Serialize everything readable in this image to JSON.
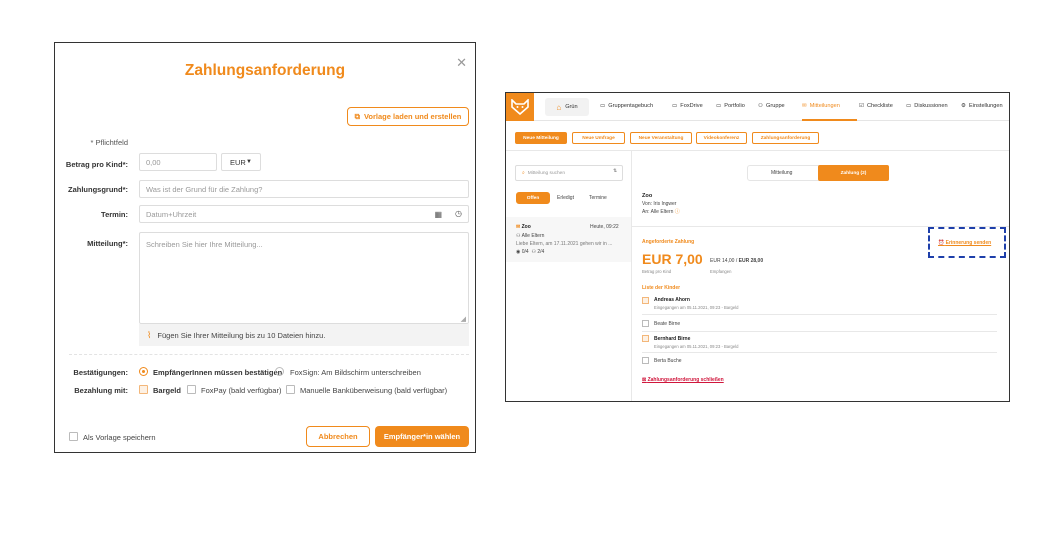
{
  "form": {
    "title": "Zahlungsanforderung",
    "close_icon": "close-icon",
    "template_button": "Vorlage laden und erstellen",
    "required_note": "* Pflichtfeld",
    "amount_label": "Betrag pro Kind*:",
    "amount_placeholder": "0,00",
    "currency": "EUR",
    "reason_label": "Zahlungsgrund*:",
    "reason_placeholder": "Was ist der Grund für die Zahlung?",
    "date_label": "Termin:",
    "date_placeholder": "Datum+Uhrzeit",
    "message_label": "Mitteilung*:",
    "message_placeholder": "Schreiben Sie hier Ihre Mitteilung...",
    "attach_text": "Fügen Sie Ihrer Mitteilung bis zu 10 Dateien hinzu.",
    "confirm_label": "Bestätigungen:",
    "confirm_option1": "EmpfängerInnen müssen bestätigen",
    "confirm_option2": "FoxSign: Am Bildschirm unterschreiben",
    "pay_label": "Bezahlung mit:",
    "pay_option1": "Bargeld",
    "pay_option2": "FoxPay (bald verfügbar)",
    "pay_option3": "Manuelle Banküberweisung (bald verfügbar)",
    "save_template": "Als Vorlage speichern",
    "cancel_button": "Abbrechen",
    "next_button": "Empfänger*in wählen",
    "accent": "#f08a1c"
  },
  "app": {
    "nav": {
      "home": "Grün",
      "items": [
        "Gruppentagebuch",
        "FoxDrive",
        "Portfolio",
        "Gruppe",
        "Mitteilungen",
        "Checkliste",
        "Diskussionen",
        "Einstellungen"
      ]
    },
    "tabs": [
      "Neue Mitteilung",
      "Neue Umfrage",
      "Neue Veranstaltung",
      "Videokonferenz",
      "Zahlungsanforderung"
    ],
    "search_placeholder": "Mitteilung suchen",
    "filters": [
      "Offen",
      "Erledigt",
      "Termine"
    ],
    "list_item": {
      "title": "Zoo",
      "time": "Heute, 09:22",
      "to": "Alle Eltern",
      "preview": "Liebe Eltern, am 17.11.2021 gehen wir in ...",
      "seen": "0/4",
      "done": "2/4"
    },
    "toggle": [
      "Mitteilung",
      "Zahlung (2)"
    ],
    "detail": {
      "title": "Zoo",
      "from": "Von: Iris Ingwer",
      "to": "An: Alle Eltern",
      "payment_heading": "Angeforderte Zahlung",
      "reminder": "Erinnerung senden",
      "amount": "EUR 7,00",
      "amount_sub": "Betrag pro Kind",
      "received": "EUR 14,00",
      "received_sep": " / ",
      "total": "EUR 28,00",
      "received_sub": "Empfangen",
      "children_heading": "Liste der Kinder",
      "children": [
        {
          "name": "Andreas Ahorn",
          "sub": "Eingegangen am 05.11.2021, 09:23 - Bargeld",
          "checked": true
        },
        {
          "name": "Beate Birne",
          "sub": "",
          "checked": false
        },
        {
          "name": "Bernhard Birne",
          "sub": "Eingegangen am 05.11.2021, 09:23 - Bargeld",
          "checked": true
        },
        {
          "name": "Berta Buche",
          "sub": "",
          "checked": false
        }
      ],
      "close_link": "Zahlungsanforderung schließen"
    }
  }
}
